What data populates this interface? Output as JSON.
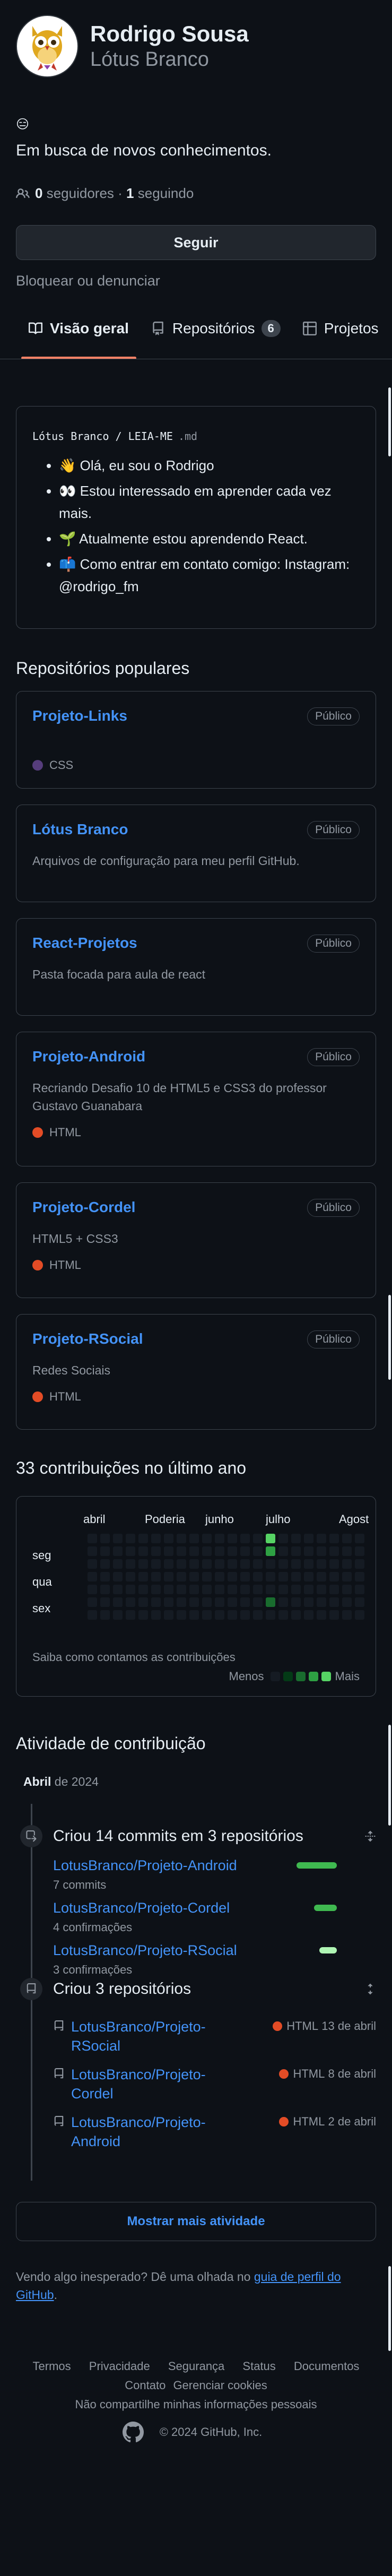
{
  "profile": {
    "fullname": "Rodrigo Sousa",
    "login": "Lótus Branco",
    "status_emoji": "😑",
    "bio": "Em busca de novos conhecimentos.",
    "followers_count": "0",
    "followers_label": "seguidores",
    "following_count": "1",
    "following_label": "seguindo",
    "separator": "·",
    "follow_button": "Seguir",
    "block_link": "Bloquear ou denunciar"
  },
  "tabs": [
    {
      "label": "Visão geral",
      "icon": "book-icon",
      "active": true
    },
    {
      "label": "Repositórios",
      "icon": "repo-icon",
      "count": "6"
    },
    {
      "label": "Projetos",
      "icon": "table-icon"
    }
  ],
  "readme": {
    "owner": "Lótus Branco",
    "slash": "/",
    "file": "LEIA-ME",
    "ext": ".md",
    "items": [
      "👋 Olá, eu sou o Rodrigo",
      "👀 Estou interessado em aprender cada vez mais.",
      "🌱 Atualmente estou aprendendo React.",
      "📫 Como entrar em contato comigo: Instagram: @rodrigo_fm"
    ]
  },
  "popular": {
    "title": "Repositórios populares",
    "repos": [
      {
        "name": "Projeto-Links",
        "badge": "Público",
        "desc": "",
        "lang": "CSS",
        "lang_color": "#563d7c"
      },
      {
        "name": "Lótus Branco",
        "badge": "Público",
        "desc": "Arquivos de configuração para meu perfil GitHub.",
        "lang": "",
        "lang_color": ""
      },
      {
        "name": "React-Projetos",
        "badge": "Público",
        "desc": "Pasta focada para aula de react",
        "lang": "",
        "lang_color": ""
      },
      {
        "name": "Projeto-Android",
        "badge": "Público",
        "desc": "Recriando Desafio 10 de HTML5 e CSS3 do professor Gustavo Guanabara",
        "lang": "HTML",
        "lang_color": "#e34c26"
      },
      {
        "name": "Projeto-Cordel",
        "badge": "Público",
        "desc": "HTML5 + CSS3",
        "lang": "HTML",
        "lang_color": "#e34c26"
      },
      {
        "name": "Projeto-RSocial",
        "badge": "Público",
        "desc": "Redes Sociais",
        "lang": "HTML",
        "lang_color": "#e34c26"
      }
    ]
  },
  "contributions": {
    "title": "33 contribuições no último ano",
    "months": [
      "abril",
      "Poderia",
      "junho",
      "julho",
      "Agost"
    ],
    "days": [
      "seg",
      "qua",
      "sex"
    ],
    "learn": "Saiba como contamos as contribuições",
    "less": "Menos",
    "more": "Mais",
    "colors": {
      "empty": "#151b23",
      "l1": "#033a16",
      "l2": "#196c2e",
      "l3": "#2ea043",
      "l4": "#56d364"
    }
  },
  "activity": {
    "title": "Atividade de contribuição",
    "month": "Abril",
    "year": "de 2024",
    "commits": {
      "title": "Criou 14 commits em 3 repositórios",
      "repos": [
        {
          "name": "LotusBranco/Projeto-Android",
          "sub": "7 commits",
          "fraction": 1.0
        },
        {
          "name": "LotusBranco/Projeto-Cordel",
          "sub": "4 confirmações",
          "fraction": 0.57
        },
        {
          "name": "LotusBranco/Projeto-RSocial",
          "sub": "3 confirmações",
          "fraction": 0.43
        }
      ]
    },
    "created": {
      "title": "Criou 3 repositórios",
      "repos": [
        {
          "name": "LotusBranco/Projeto-RSocial",
          "lang": "HTML",
          "date": "13 de abril"
        },
        {
          "name": "LotusBranco/Projeto-Cordel",
          "lang": "HTML",
          "date": "8 de abril"
        },
        {
          "name": "LotusBranco/Projeto-Android",
          "lang": "HTML",
          "date": "2 de abril"
        }
      ]
    },
    "more_button": "Mostrar mais atividade",
    "hint_prefix": "Vendo algo inesperado? Dê uma olhada no",
    "hint_link": "guia de perfil do GitHub",
    "hint_suffix": "."
  },
  "footer": {
    "links_row1": [
      "Termos",
      "Privacidade",
      "Segurança",
      "Status",
      "Documentos"
    ],
    "links_row2": [
      "Contato",
      "Gerenciar cookies"
    ],
    "privacy": "Não compartilhe minhas informações pessoais",
    "copyright": "© 2024 GitHub, Inc."
  }
}
